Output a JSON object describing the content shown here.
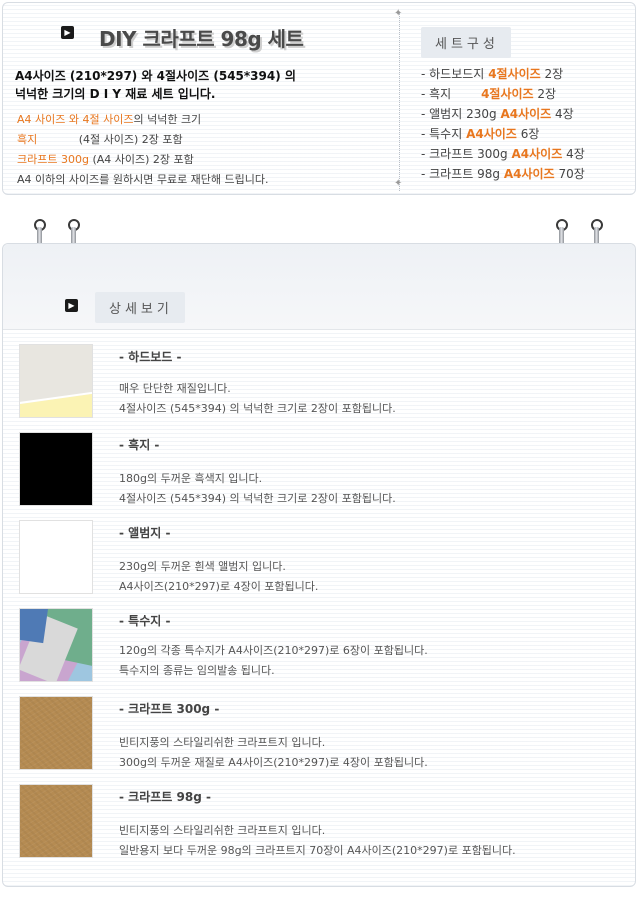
{
  "top": {
    "title": "DIY 크라프트 98g 세트",
    "intro_line1": "A4사이즈 (210*297) 와 4절사이즈 (545*394) 의",
    "intro_line2": "넉넉한 크기의 D I Y 재료 세트 입니다.",
    "detail_lines": [
      {
        "hl": "A4 사이즈 와 4절 사이즈",
        "rest": "의 넉넉한 크기"
      },
      {
        "hl": "흑지",
        "rest": "(4절 사이즈) 2장 포함"
      },
      {
        "hl": "크라프트 300g",
        "rest": "(A4 사이즈) 2장 포함"
      },
      {
        "hl": "",
        "rest": "A4 이하의 사이즈를 원하시면 무료로 재단해 드립니다."
      }
    ]
  },
  "set": {
    "label": "세트구성",
    "items": [
      {
        "pre": "- 하드보드지",
        "hl": "4절사이즈",
        "post": "2장"
      },
      {
        "pre": "- 흑지",
        "hl": "4절사이즈",
        "post": "2장"
      },
      {
        "pre": "- 앨범지 230g",
        "hl": "A4사이즈",
        "post": "4장"
      },
      {
        "pre": "- 특수지",
        "hl": "A4사이즈",
        "post": "6장"
      },
      {
        "pre": "- 크라프트 300g",
        "hl": "A4사이즈",
        "post": "4장"
      },
      {
        "pre": "- 크라프트 98g",
        "hl": "A4사이즈",
        "post": "70장"
      }
    ]
  },
  "detail_view": {
    "label": "상세보기",
    "items": [
      {
        "title": "- 하드보드 -",
        "desc1": "매우 단단한 재질입니다.",
        "desc2": "4절사이즈 (545*394) 의 넉넉한 크기로 2장이 포함됩니다.",
        "thumb": "hardboard"
      },
      {
        "title": "- 흑지 -",
        "desc1": "180g의 두꺼운 흑색지 입니다.",
        "desc2": "4절사이즈 (545*394) 의 넉넉한 크기로 2장이 포함됩니다.",
        "thumb": "black"
      },
      {
        "title": "- 앨범지 -",
        "desc1": "230g의 두꺼운 흰색 앨범지 입니다.",
        "desc2": "A4사이즈(210*297)로 4장이 포함됩니다.",
        "thumb": "album"
      },
      {
        "title": "- 특수지 -",
        "desc1": "120g의 각종 특수지가 A4사이즈(210*297)로 6장이 포함됩니다.",
        "desc2": "특수지의 종류는 임의발송 됩니다.",
        "thumb": "special"
      },
      {
        "title": "- 크라프트 300g -",
        "desc1": "빈티지풍의 스타일리쉬한 크라프트지 입니다.",
        "desc2": "300g의 두꺼운 재질로 A4사이즈(210*297)로 4장이 포함됩니다.",
        "thumb": "kraft"
      },
      {
        "title": "- 크라프트 98g -",
        "desc1": "빈티지풍의 스타일리쉬한 크라프트지 입니다.",
        "desc2": "일반용지 보다 두꺼운 98g의 크라프트지 70장이 A4사이즈(210*297)로 포함됩니다.",
        "thumb": "kraft"
      }
    ]
  },
  "colors": {
    "accent": "#e8771f",
    "tab_bg": "#e7ebf0"
  }
}
